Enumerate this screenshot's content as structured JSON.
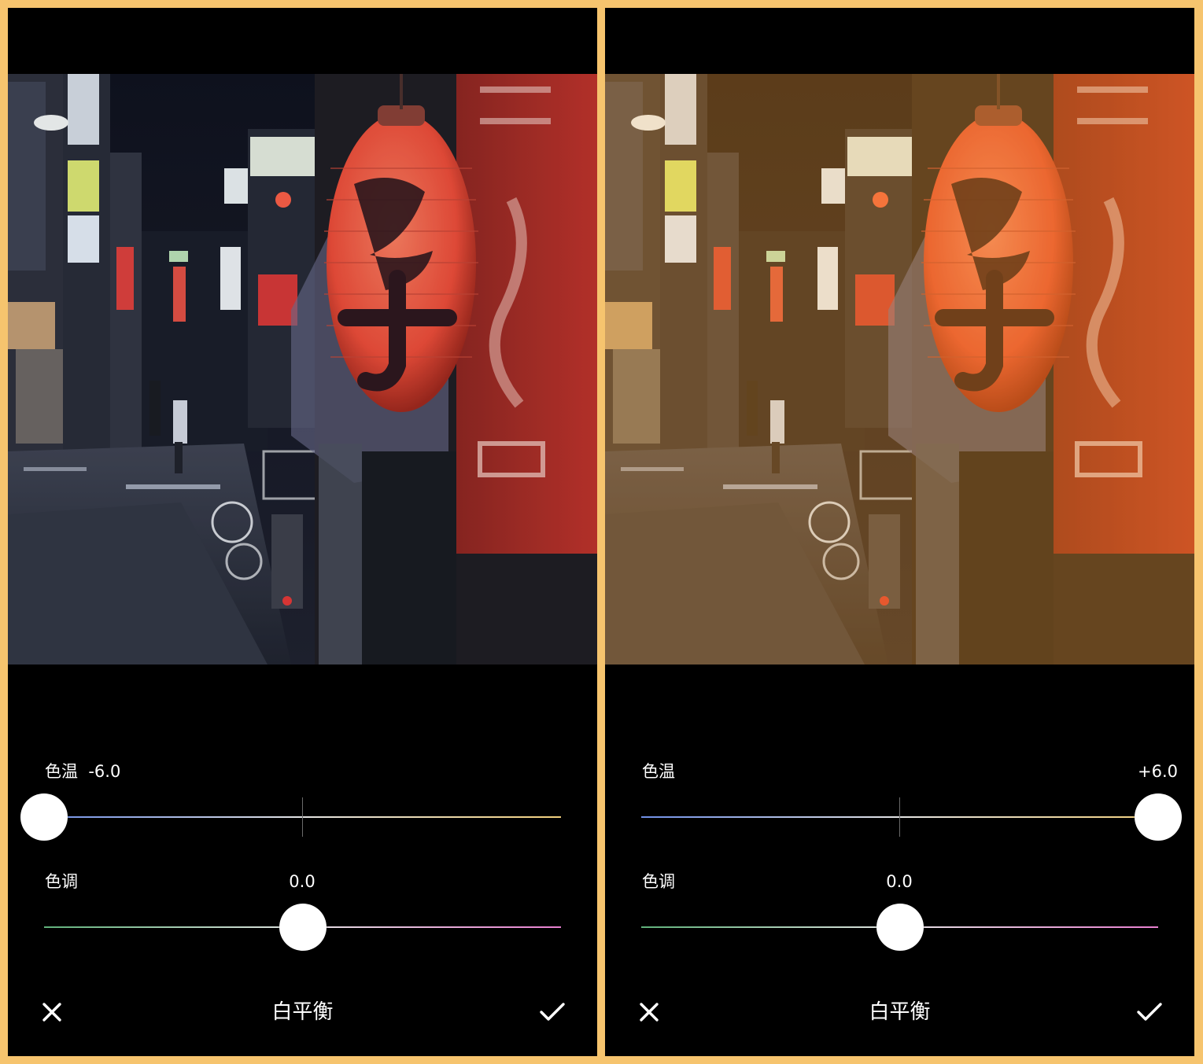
{
  "panels": [
    {
      "id": "left",
      "temperature": {
        "label": "色温",
        "value_text": "-6.0",
        "value": -6.0,
        "min": -6.0,
        "max": 6.0
      },
      "tint": {
        "label": "色调",
        "value_text": "0.0",
        "value": 0.0,
        "min": -6.0,
        "max": 6.0
      },
      "title": "白平衡",
      "cancel_icon": "close-icon",
      "confirm_icon": "checkmark-icon"
    },
    {
      "id": "right",
      "temperature": {
        "label": "色温",
        "value_text": "+6.0",
        "value": 6.0,
        "min": -6.0,
        "max": 6.0
      },
      "tint": {
        "label": "色调",
        "value_text": "0.0",
        "value": 0.0,
        "min": -6.0,
        "max": 6.0
      },
      "title": "白平衡",
      "cancel_icon": "close-icon",
      "confirm_icon": "checkmark-icon"
    }
  ],
  "colors": {
    "frame_background": "#f6c46e",
    "temperature_cool": "#6f8fe6",
    "temperature_warm": "#f1cf7c",
    "tint_green": "#5fb07a",
    "tint_magenta": "#e77fd0"
  }
}
